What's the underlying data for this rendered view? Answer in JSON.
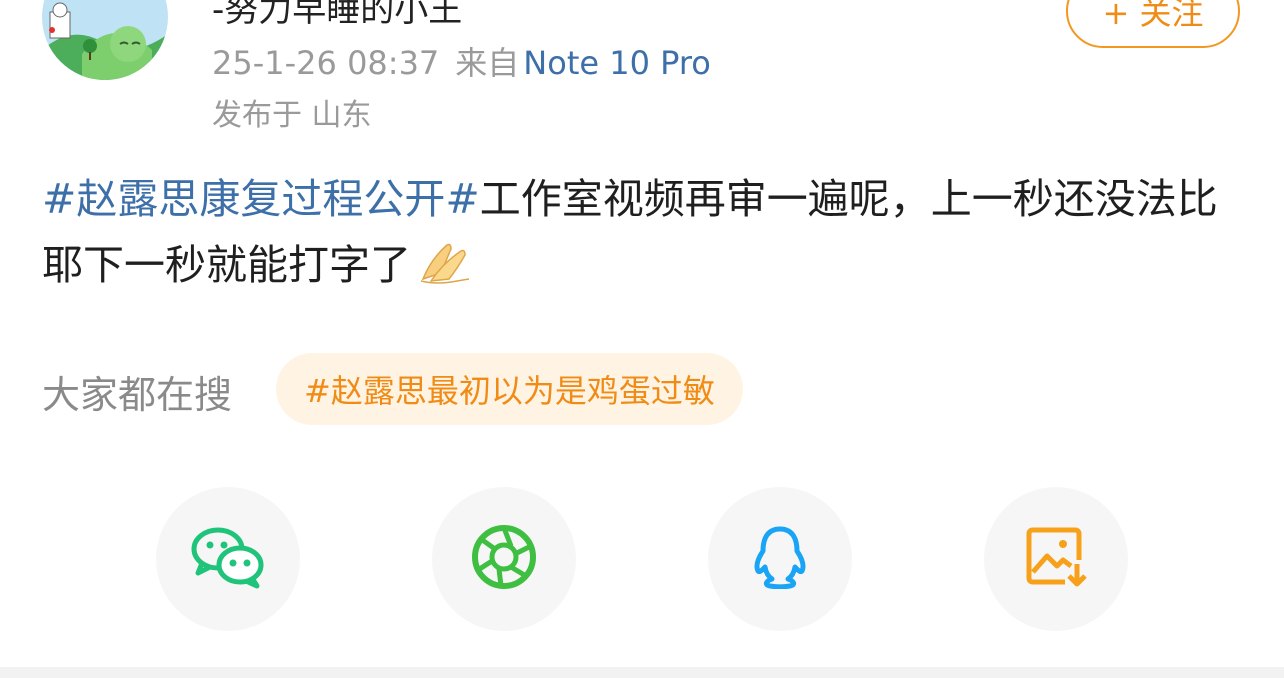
{
  "header": {
    "username": "-努力早睡的小王",
    "timestamp": "25-1-26 08:37",
    "from_label": "来自",
    "device": "Note 10 Pro",
    "location": "发布于 山东",
    "follow_label": "+ 关注"
  },
  "post": {
    "topic": "#赵露思康复过程公开#",
    "text": "工作室视频再审一遍呢，上一秒还没法比耶下一秒就能打字了"
  },
  "trending": {
    "label": "大家都在搜",
    "tag": "#赵露思最初以为是鸡蛋过敏"
  },
  "share": {
    "buttons": [
      {
        "icon": "wechat-icon",
        "color": "#1fc47a"
      },
      {
        "icon": "moments-icon",
        "color": "#3ebf41"
      },
      {
        "icon": "qq-icon",
        "color": "#1aa4f5"
      },
      {
        "icon": "save-image-icon",
        "color": "#f7a11b"
      }
    ]
  },
  "colors": {
    "accent": "#f08c16",
    "link": "#3d6fa8",
    "muted": "#9a9a9a"
  }
}
